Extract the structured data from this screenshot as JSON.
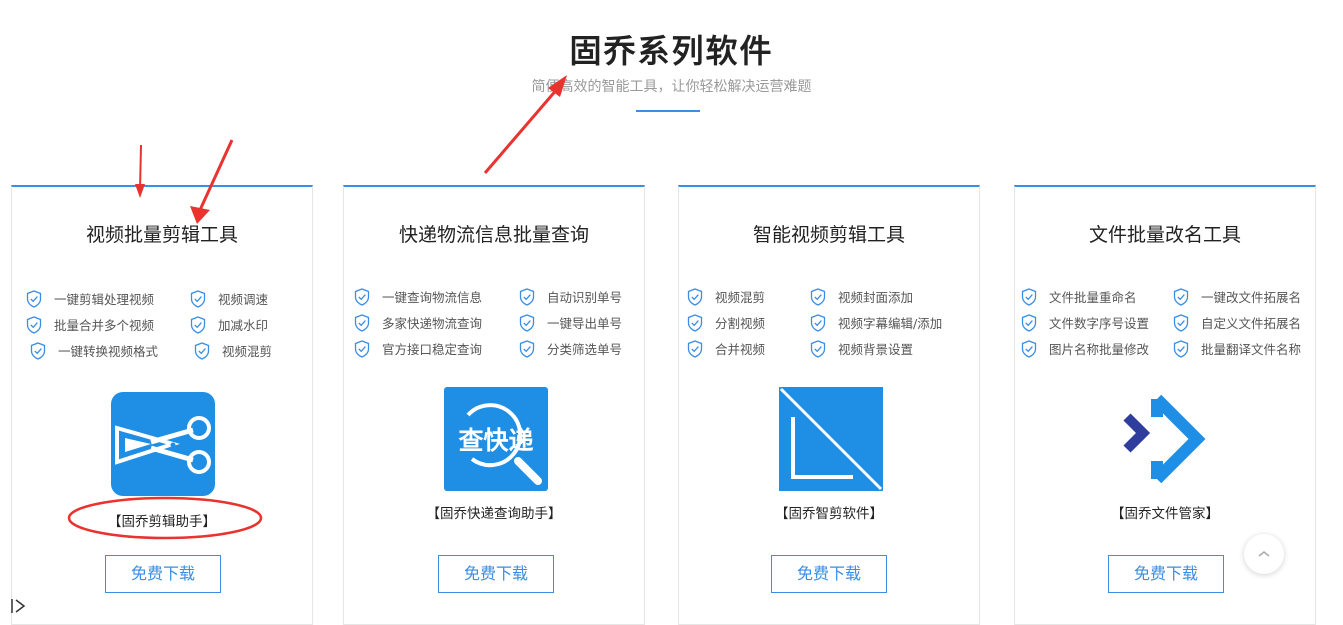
{
  "header": {
    "title": "固乔系列软件",
    "subtitle": "简便高效的智能工具，让你轻松解决运营难题"
  },
  "cards": [
    {
      "title": "视频批量剪辑工具",
      "features": [
        "一键剪辑处理视频",
        "视频调速",
        "批量合并多个视频",
        "加减水印",
        "一键转换视频格式",
        "视频混剪"
      ],
      "product": "【固乔剪辑助手】",
      "button": "免费下载",
      "icon": "scissors-logo-icon"
    },
    {
      "title": "快递物流信息批量查询",
      "features": [
        "一键查询物流信息",
        "自动识别单号",
        "多家快递物流查询",
        "一键导出单号",
        "官方接口稳定查询",
        "分类筛选单号"
      ],
      "product": "【固乔快递查询助手】",
      "button": "免费下载",
      "icon": "express-query-logo-icon",
      "logo_text": "查快递"
    },
    {
      "title": "智能视频剪辑工具",
      "features": [
        "视频混剪",
        "视频封面添加",
        "分割视频",
        "视频字幕编辑/添加",
        "合并视频",
        "视频背景设置"
      ],
      "product": "【固乔智剪软件】",
      "button": "免费下载",
      "icon": "smart-cut-logo-icon"
    },
    {
      "title": "文件批量改名工具",
      "features": [
        "文件批量重命名",
        "一键改文件拓展名",
        "文件数字序号设置",
        "自定义文件拓展名",
        "图片名称批量修改",
        "批量翻译文件名称"
      ],
      "product": "【固乔文件管家】",
      "button": "免费下载",
      "icon": "file-manager-logo-icon"
    }
  ],
  "colors": {
    "accent": "#3a8ee6",
    "annotation": "#e8332f"
  }
}
